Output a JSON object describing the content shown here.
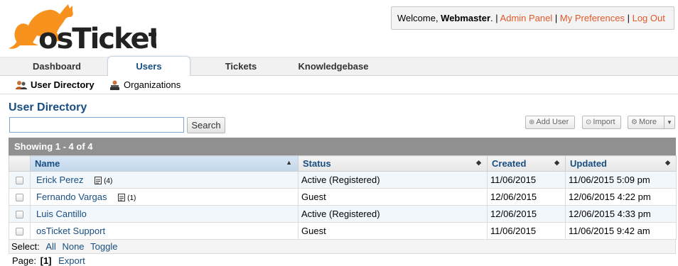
{
  "app": {
    "logo_text": "osTicket"
  },
  "header": {
    "welcome_prefix": "Welcome, ",
    "username": "Webmaster",
    "links": [
      "Admin Panel",
      "My Preferences",
      "Log Out"
    ]
  },
  "nav": {
    "tabs": [
      "Dashboard",
      "Users",
      "Tickets",
      "Knowledgebase"
    ],
    "active": "Users"
  },
  "subnav": {
    "items": [
      "User Directory",
      "Organizations"
    ],
    "active": "User Directory"
  },
  "page": {
    "title": "User Directory"
  },
  "search": {
    "value": "",
    "button": "Search"
  },
  "actions": {
    "add_user": "Add User",
    "import": "Import",
    "more": "More"
  },
  "table": {
    "showing": "Showing  1 - 4 of 4",
    "columns": [
      "Name",
      "Status",
      "Created",
      "Updated"
    ],
    "sorted_column": "Name",
    "rows": [
      {
        "name": "Erick Perez",
        "notes": "(4)",
        "status": "Active (Registered)",
        "created": "11/06/2015",
        "updated": "11/06/2015 5:09 pm"
      },
      {
        "name": "Fernando Vargas",
        "notes": "(1)",
        "status": "Guest",
        "created": "12/06/2015",
        "updated": "12/06/2015 4:22 pm"
      },
      {
        "name": "Luis Cantillo",
        "notes": "",
        "status": "Active (Registered)",
        "created": "12/06/2015",
        "updated": "12/06/2015 4:33 pm"
      },
      {
        "name": "osTicket Support",
        "notes": "",
        "status": "Guest",
        "created": "11/06/2015",
        "updated": "11/06/2015 9:42 am"
      }
    ]
  },
  "select": {
    "label": "Select:",
    "options": [
      "All",
      "None",
      "Toggle"
    ]
  },
  "pager": {
    "label": "Page:",
    "current": "[1]",
    "export": "Export"
  },
  "colors": {
    "link": "#184e81",
    "header_link": "#e0592a",
    "logo_orange": "#f7921e",
    "logo_text": "#222222"
  },
  "icons": {
    "user_directory": "users-icon",
    "organizations": "organization-icon",
    "notes": "note-icon"
  }
}
